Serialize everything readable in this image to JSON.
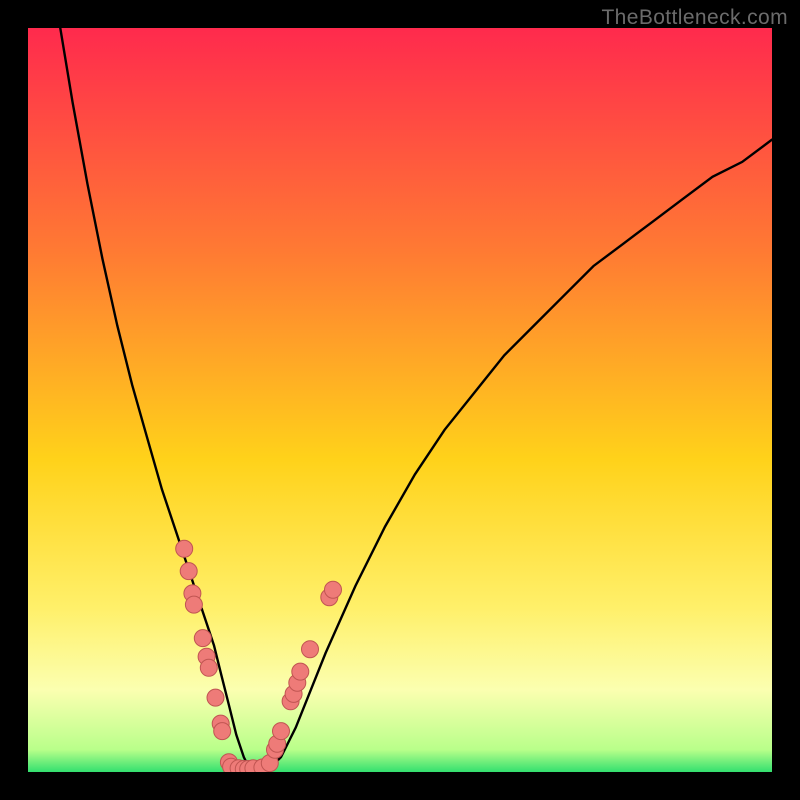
{
  "watermark": "TheBottleneck.com",
  "colors": {
    "frame": "#000000",
    "top": "#ff2a4d",
    "mid_upper": "#ff7a33",
    "mid": "#ffd21a",
    "mid_lower": "#fff06a",
    "pale_band": "#fbffb0",
    "green": "#33e06f",
    "curve": "#000000",
    "dot_fill": "#ee7b78",
    "dot_stroke": "#c05552"
  },
  "chart_data": {
    "type": "line",
    "title": "",
    "xlabel": "",
    "ylabel": "",
    "xlim": [
      0,
      100
    ],
    "ylim": [
      0,
      100
    ],
    "x": [
      4,
      6,
      8,
      10,
      12,
      14,
      16,
      18,
      20,
      21,
      22,
      23,
      24,
      25,
      26,
      27,
      28,
      29,
      30,
      32,
      34,
      36,
      38,
      40,
      44,
      48,
      52,
      56,
      60,
      64,
      68,
      72,
      76,
      80,
      84,
      88,
      92,
      96,
      100
    ],
    "values": [
      102,
      90,
      79,
      69,
      60,
      52,
      45,
      38,
      32,
      29,
      26,
      23,
      20,
      17,
      13,
      9,
      5,
      2,
      0,
      0,
      2,
      6,
      11,
      16,
      25,
      33,
      40,
      46,
      51,
      56,
      60,
      64,
      68,
      71,
      74,
      77,
      80,
      82,
      85
    ],
    "scatter_points": [
      {
        "x": 21.0,
        "y": 30.0
      },
      {
        "x": 21.6,
        "y": 27.0
      },
      {
        "x": 22.1,
        "y": 24.0
      },
      {
        "x": 22.3,
        "y": 22.5
      },
      {
        "x": 23.5,
        "y": 18.0
      },
      {
        "x": 24.0,
        "y": 15.5
      },
      {
        "x": 24.3,
        "y": 14.0
      },
      {
        "x": 25.2,
        "y": 10.0
      },
      {
        "x": 25.9,
        "y": 6.5
      },
      {
        "x": 26.1,
        "y": 5.5
      },
      {
        "x": 27.0,
        "y": 1.3
      },
      {
        "x": 27.3,
        "y": 0.7
      },
      {
        "x": 28.3,
        "y": 0.5
      },
      {
        "x": 29.0,
        "y": 0.4
      },
      {
        "x": 29.6,
        "y": 0.4
      },
      {
        "x": 30.3,
        "y": 0.5
      },
      {
        "x": 31.5,
        "y": 0.6
      },
      {
        "x": 32.5,
        "y": 1.2
      },
      {
        "x": 33.2,
        "y": 3.0
      },
      {
        "x": 33.5,
        "y": 3.8
      },
      {
        "x": 34.0,
        "y": 5.5
      },
      {
        "x": 35.3,
        "y": 9.5
      },
      {
        "x": 35.7,
        "y": 10.5
      },
      {
        "x": 36.2,
        "y": 12.0
      },
      {
        "x": 36.6,
        "y": 13.5
      },
      {
        "x": 37.9,
        "y": 16.5
      },
      {
        "x": 40.5,
        "y": 23.5
      },
      {
        "x": 41.0,
        "y": 24.5
      }
    ]
  }
}
